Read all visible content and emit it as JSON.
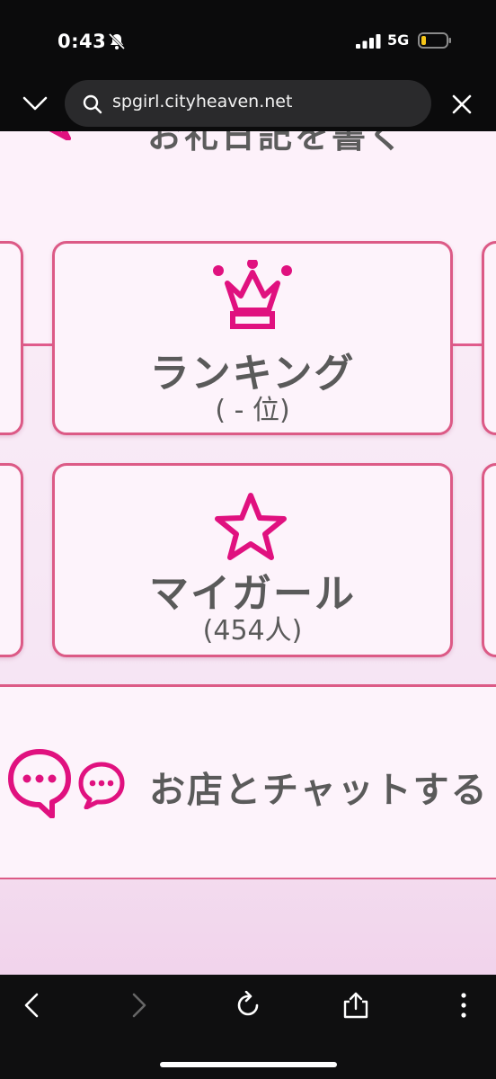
{
  "status_bar": {
    "time": "0:43",
    "network": "5G"
  },
  "browser": {
    "url": "spgirl.cityheaven.net"
  },
  "diary": {
    "label": "お礼日記を書く"
  },
  "ranking": {
    "title": "ランキング",
    "sub": "( - 位)"
  },
  "mygirl": {
    "title": "マイガール",
    "sub": "(454人)"
  },
  "chat": {
    "label": "お店とチャットする"
  },
  "colors": {
    "accent": "#e0117f",
    "border": "#dc5a86",
    "text": "#5a5a5a"
  }
}
